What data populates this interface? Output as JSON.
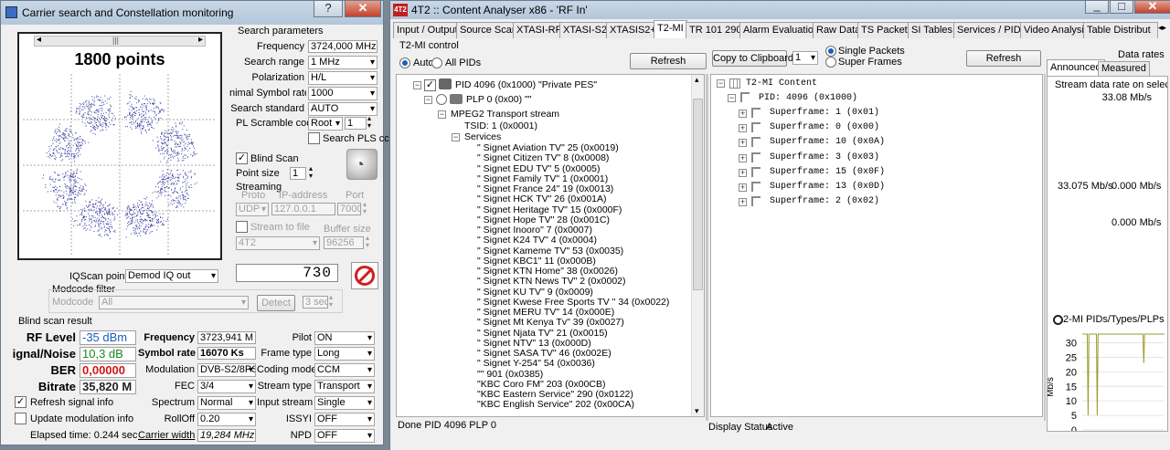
{
  "left_window": {
    "title": "Carrier search and Constellation monitoring",
    "help_button": "?",
    "points_label": "1800 points",
    "search_params": {
      "heading": "Search parameters",
      "frequency_label": "Frequency",
      "frequency_value": "3724,000 MHz",
      "search_range_label": "Search range",
      "search_range_value": "1 MHz",
      "polarization_label": "Polarization",
      "polarization_value": "H/L",
      "symbol_rate_label": "nimal Symbol rate",
      "symbol_rate_value": "1000",
      "search_standard_label": "Search standard",
      "search_standard_value": "AUTO",
      "pl_scramble_label": "PL Scramble code",
      "pl_scramble_mode": "Root",
      "pl_scramble_value": "1",
      "search_pls_label": "Search PLS cc"
    },
    "blind_scan_label": "Blind Scan",
    "point_size_label": "Point size",
    "point_size_value": "1",
    "streaming": {
      "heading": "Streaming",
      "proto_label": "Proto",
      "proto_value": "UDP",
      "ip_label": "IP-address",
      "ip_value": "127.0.0.1",
      "port_label": "Port",
      "port_value": "7000",
      "stream_to_file_label": "Stream to file",
      "buffer_size_label": "Buffer size",
      "file_value": "4T2",
      "buffer_value": "96256"
    },
    "counter_value": "730",
    "iqscan_label": "IQScan point",
    "iqscan_value": "Demod IQ out",
    "modcode_filter_label": "Modcode filter",
    "modcode_label": "Modcode",
    "modcode_value": "All",
    "detect_button": "Detect",
    "detect_time": "3 sec",
    "result": {
      "heading": "Blind scan result",
      "rf_level_label": "RF Level",
      "rf_level_value": "-35 dBm",
      "snr_label": "ignal/Noise",
      "snr_value": "10,3 dB",
      "ber_label": "BER",
      "ber_value": "0,00000",
      "bitrate_label": "Bitrate",
      "bitrate_value": "35,820 M",
      "frequency_label": "Frequency",
      "frequency_value": "3723,941 M",
      "symbol_rate_label": "Symbol rate",
      "symbol_rate_value": "16070 Ks",
      "modulation_label": "Modulation",
      "modulation_value": "DVB-S2/8PS",
      "fec_label": "FEC",
      "fec_value": "3/4",
      "spectrum_label": "Spectrum",
      "spectrum_value": "Normal",
      "rolloff_label": "RollOff",
      "rolloff_value": "0.20",
      "carrier_width_label": "Carrier width",
      "carrier_width_value": "19,284 MHz",
      "pilot_label": "Pilot",
      "pilot_value": "ON",
      "frame_type_label": "Frame type",
      "frame_type_value": "Long",
      "coding_mode_label": "Coding mode",
      "coding_mode_value": "CCM",
      "stream_type_label": "Stream type",
      "stream_type_value": "Transport",
      "input_stream_label": "Input stream",
      "input_stream_value": "Single",
      "issyi_label": "ISSYI",
      "issyi_value": "OFF",
      "npd_label": "NPD",
      "npd_value": "OFF"
    },
    "refresh_signal_label": "Refresh signal info",
    "update_modulation_label": "Update modulation info",
    "elapsed_label": "Elapsed time: 0.244 sec"
  },
  "right_window": {
    "title": "4T2 :: Content Analyser x86  - 'RF In'",
    "app_icon_text": "4T2",
    "tabs": [
      "Input / Output",
      "Source Scan",
      "XTASI-RF",
      "XTASI-S2",
      "XTASIS2+",
      "T2-MI",
      "TR 101 290",
      "Alarm Evaluation",
      "Raw Data",
      "TS Packets",
      "SI Tables",
      "Services / PIDs",
      "Video Analysis",
      "Table Distribut"
    ],
    "t2mi_control_label": "T2-MI control",
    "auto_label": "Auto",
    "all_pids_label": "All PIDs",
    "refresh_label": "Refresh",
    "pid_node": "PID 4096 (0x1000) \"Private PES\"",
    "plp_node": "PLP 0 (0x00) \"\"",
    "mpeg2_node": "MPEG2 Transport stream",
    "tsid_node": "TSID: 1 (0x0001)",
    "services_node": "Services",
    "services": [
      "\" Signet Aviation TV\" 25 (0x0019)",
      "\" Signet Citizen TV\" 8 (0x0008)",
      "\" Signet EDU TV\" 5 (0x0005)",
      "\" Signet Family TV\" 1 (0x0001)",
      "\" Signet France 24\" 19 (0x0013)",
      "\" Signet HCK TV\" 26 (0x001A)",
      "\" Signet Heritage TV\" 15 (0x000F)",
      "\" Signet Hope TV\" 28 (0x001C)",
      "\" Signet Inooro\" 7 (0x0007)",
      "\" Signet K24 TV\" 4 (0x0004)",
      "\" Signet Kameme TV\" 53 (0x0035)",
      "\" Signet KBC1\" 11 (0x000B)",
      "\" Signet KTN Home\" 38 (0x0026)",
      "\" Signet KTN News TV\" 2 (0x0002)",
      "\" Signet KU TV\" 9 (0x0009)",
      "\" Signet Kwese Free Sports TV \" 34 (0x0022)",
      "\" Signet MERU TV\" 14 (0x000E)",
      "\" Signet Mt Kenya Tv\" 39 (0x0027)",
      "\" Signet Njata TV\" 21 (0x0015)",
      "\" Signet NTV\" 13 (0x000D)",
      "\" Signet SASA TV\" 46 (0x002E)",
      "\" Signet Y-254\" 54 (0x0036)",
      "\"\" 901 (0x0385)",
      "\"KBC Coro FM\" 203 (0x00CB)",
      "\"KBC Eastern Service\" 290 (0x0122)",
      "\"KBC English Service\" 202 (0x00CA)"
    ],
    "copy_clipboard_label": "Copy to Clipboard",
    "copy_count_value": "1",
    "single_packets_label": "Single Packets",
    "super_frames_label": "Super Frames",
    "content_root": "T2-MI Content",
    "content_pid": "PID: 4096 (0x1000)",
    "superframes": [
      "Superframe: 1 (0x01)",
      "Superframe: 0 (0x00)",
      "Superframe: 10 (0x0A)",
      "Superframe: 3 (0x03)",
      "Superframe: 15 (0x0F)",
      "Superframe: 13 (0x0D)",
      "Superframe: 2 (0x02)"
    ],
    "data_rates_label": "Data rates",
    "announced_tab": "Announced",
    "measured_tab": "Measured",
    "stream_rate_label": "Stream data rate on selecte",
    "stream_rate_value": "33.08 Mb/s",
    "rate_a": "33.075 Mb/s",
    "rate_b": "0.000 Mb/s",
    "rate_c": "0.000 Mb/s",
    "pids_title": "2-MI PIDs/Types/PLPs",
    "status_left": "Done PID 4096  PLP 0",
    "display_status_label": "Display Status",
    "display_status_value": "Active"
  },
  "chart_data": [
    {
      "type": "scatter",
      "title": "1800 points",
      "description_points": 1800,
      "shape": "8PSK ring constellation"
    },
    {
      "type": "line",
      "title": "2-MI PIDs/Types/PLPs",
      "ylabel": "Mb/s",
      "yticks": [
        0,
        5,
        10,
        15,
        20,
        25,
        30
      ],
      "ylim": [
        0,
        33
      ],
      "series": [
        {
          "values": [
            33,
            33,
            33,
            33,
            33,
            33,
            33,
            5,
            33,
            33,
            33,
            33,
            33,
            33,
            33,
            33,
            33,
            33,
            5,
            33,
            33,
            33,
            33,
            33,
            33,
            33,
            33,
            33,
            33,
            33,
            33,
            33,
            33,
            33,
            33,
            33,
            33,
            33,
            33,
            33,
            33,
            33,
            33,
            33,
            33,
            33,
            33,
            33,
            33,
            33,
            33,
            33,
            33,
            33,
            33,
            33,
            33,
            33,
            33,
            33,
            33,
            33,
            33,
            33,
            33,
            33,
            33,
            33,
            33,
            33,
            33,
            33,
            33,
            33,
            23,
            33,
            33,
            33,
            33,
            33,
            33,
            33,
            33,
            33,
            33,
            33,
            33,
            33,
            33,
            33,
            33,
            33,
            33,
            33,
            33,
            33,
            33,
            33,
            33,
            33
          ]
        }
      ]
    }
  ]
}
